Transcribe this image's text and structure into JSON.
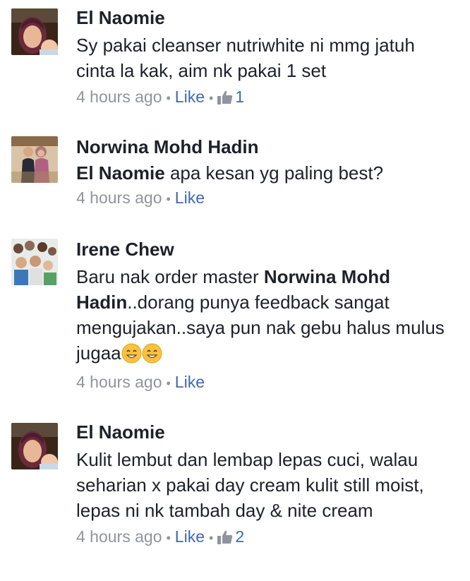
{
  "comments": [
    {
      "author": "El Naomie",
      "text": "Sy pakai cleanser nutriwhite ni mmg jatuh cinta la kak, aim nk pakai 1 set",
      "time": "4 hours ago",
      "like_label": "Like",
      "like_count": "1"
    },
    {
      "author": "Norwina Mohd Hadin",
      "mention": "El Naomie",
      "text": " apa kesan yg paling best?",
      "time": "4 hours ago",
      "like_label": "Like"
    },
    {
      "author": "Irene Chew",
      "text_before": "Baru nak order master ",
      "mention": "Norwina Mohd Hadin",
      "text_after": "..dorang punya feedback sangat mengujakan..saya pun nak gebu halus mulus jugaa",
      "time": "4 hours ago",
      "like_label": "Like"
    },
    {
      "author": "El Naomie",
      "text": "Kulit lembut dan lembap lepas cuci, walau seharian x pakai day cream kulit still moist, lepas ni nk tambah day & nite cream",
      "time": "4 hours ago",
      "like_label": "Like",
      "like_count": "2"
    }
  ],
  "colors": {
    "name": "#1d2129",
    "meta": "#90949c",
    "link": "#4267b2"
  },
  "icons": [
    "thumbs-up-icon",
    "grin-emoji-icon"
  ]
}
